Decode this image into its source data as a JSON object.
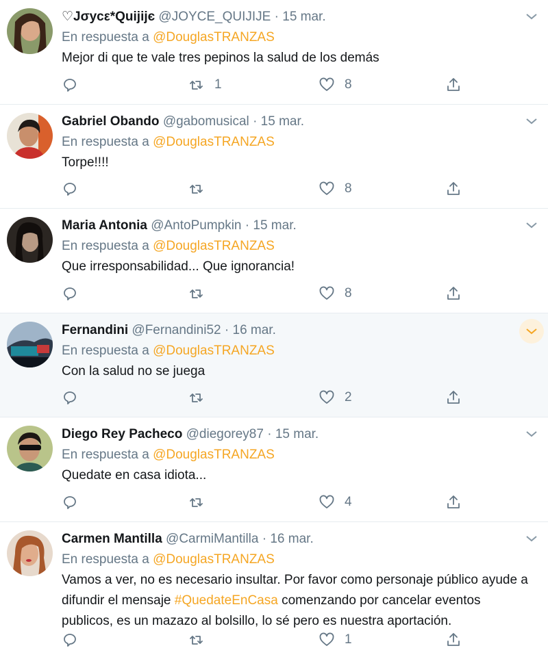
{
  "colors": {
    "accent": "#f5a623",
    "muted": "#657786",
    "text": "#14171a",
    "highlight": "#f5f8fa"
  },
  "reply_prefix": "En respuesta a",
  "reply_target": "@DouglasTRANZAS",
  "tweets": [
    {
      "name": "♡Jσуcε*Quijijє",
      "handle": "@JOYCE_QUIJIJE",
      "sep": "·",
      "date": "15 mar.",
      "text": "Mejor di que te vale tres pepinos la salud de los demás",
      "retweets": "1",
      "likes": "8"
    },
    {
      "name": "Gabriel Obando",
      "handle": "@gabomusical",
      "sep": "·",
      "date": "15 mar.",
      "text": "Torpe!!!!",
      "retweets": "",
      "likes": "8"
    },
    {
      "name": "Maria Antonia",
      "handle": "@AntoPumpkin",
      "sep": "·",
      "date": "15 mar.",
      "text": "Que irresponsabilidad... Que ignorancia!",
      "retweets": "",
      "likes": "8"
    },
    {
      "name": "Fernandini",
      "handle": "@Fernandini52",
      "sep": "·",
      "date": "16 mar.",
      "text": "Con la salud no se juega",
      "retweets": "",
      "likes": "2"
    },
    {
      "name": "Diego Rey Pacheco",
      "handle": "@diegorey87",
      "sep": "·",
      "date": "15 mar.",
      "text": "Quedate en casa idiota...",
      "retweets": "",
      "likes": "4"
    },
    {
      "name": "Carmen Mantilla",
      "handle": "@CarmiMantilla",
      "sep": "·",
      "date": "16 mar.",
      "text_before": "Vamos a ver, no es necesario insultar. Por favor como personaje público ayude a difundir el mensaje ",
      "hashtag": "#QuedateEnCasa",
      "text_after": " comenzando por cancelar eventos publicos, es un mazazo al bolsillo, lo sé pero es nuestra aportación.",
      "retweets": "",
      "likes": "1"
    }
  ]
}
